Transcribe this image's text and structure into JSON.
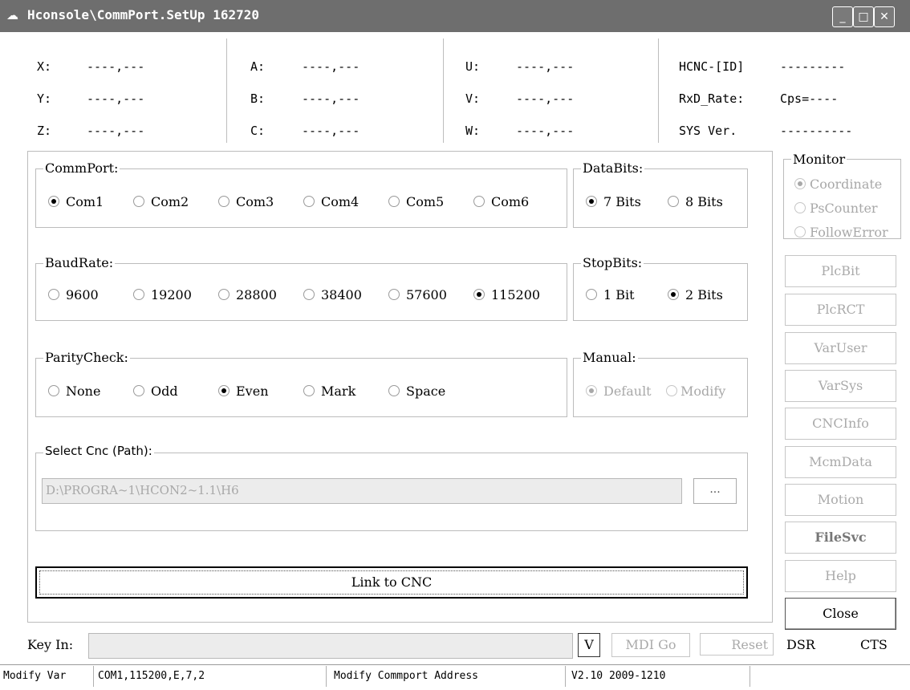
{
  "window": {
    "title": "Hconsole\\CommPort.SetUp 162720",
    "controls": {
      "minimize": "_",
      "maximize": "□",
      "close": "✕"
    }
  },
  "coords": {
    "col1": [
      {
        "label": "X:",
        "value": "----,---"
      },
      {
        "label": "Y:",
        "value": "----,---"
      },
      {
        "label": "Z:",
        "value": "----,---"
      }
    ],
    "col2": [
      {
        "label": "A:",
        "value": "----,---"
      },
      {
        "label": "B:",
        "value": "----,---"
      },
      {
        "label": "C:",
        "value": "----,---"
      }
    ],
    "col3": [
      {
        "label": "U:",
        "value": "----,---"
      },
      {
        "label": "V:",
        "value": "----,---"
      },
      {
        "label": "W:",
        "value": "----,---"
      }
    ],
    "info": [
      {
        "label": "HCNC-[ID]",
        "value": "---------"
      },
      {
        "label": "RxD_Rate:",
        "value": "Cps=----"
      },
      {
        "label": "SYS Ver.",
        "value": "----------"
      }
    ]
  },
  "commport": {
    "label": "CommPort:",
    "options": [
      "Com1",
      "Com2",
      "Com3",
      "Com4",
      "Com5",
      "Com6"
    ],
    "selected": "Com1"
  },
  "databits": {
    "label": "DataBits:",
    "options": [
      "7 Bits",
      "8 Bits"
    ],
    "selected": "7 Bits"
  },
  "baudrate": {
    "label": "BaudRate:",
    "options": [
      "9600",
      "19200",
      "28800",
      "38400",
      "57600",
      "115200"
    ],
    "selected": "115200"
  },
  "stopbits": {
    "label": "StopBits:",
    "options": [
      "1 Bit",
      "2 Bits"
    ],
    "selected": "2 Bits"
  },
  "parity": {
    "label": "ParityCheck:",
    "options": [
      "None",
      "Odd",
      "Even",
      "Mark",
      "Space"
    ],
    "selected": "Even"
  },
  "manual": {
    "label": "Manual:",
    "options": [
      "Default",
      "Modify"
    ],
    "selected": "Default"
  },
  "path": {
    "label": "Select Cnc (Path):",
    "value": "D:\\PROGRA~1\\HCON2~1.1\\H6",
    "browse_label": "..."
  },
  "link_button": "Link to CNC",
  "monitor": {
    "label": "Monitor",
    "options": [
      "Coordinate",
      "PsCounter",
      "FollowError"
    ],
    "selected": "Coordinate"
  },
  "side_buttons": {
    "plcbit": "PlcBit",
    "plcrct": "PlcRCT",
    "varuser": "VarUser",
    "varsys": "VarSys",
    "cncinfo": "CNCInfo",
    "mcmdata": "McmData",
    "motion": "Motion",
    "filesvc": "FileSvc",
    "help": "Help",
    "close": "Close"
  },
  "keyin": {
    "label": "Key In:",
    "value": "",
    "v_label": "V",
    "mdi_label": "MDI Go",
    "reset_label": "Reset"
  },
  "signals": {
    "dsr": "DSR",
    "cts": "CTS"
  },
  "statusbar": {
    "mode": "Modify Var",
    "port": "COM1,115200,E,7,2",
    "message": "Modify Commport Address",
    "version": "V2.10 2009-1210"
  }
}
